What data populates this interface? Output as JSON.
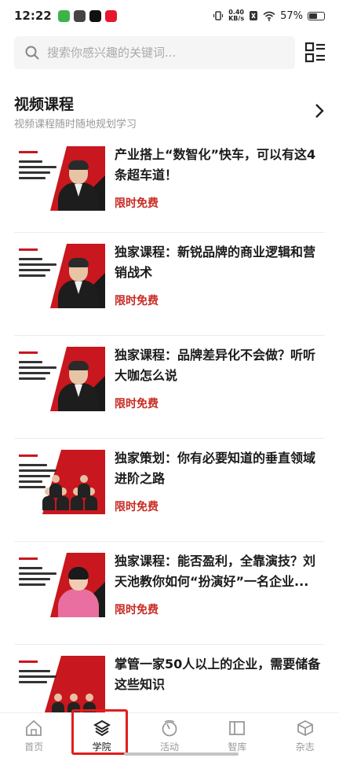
{
  "status_bar": {
    "time": "12:22",
    "net_speed_value": "0.40",
    "net_speed_unit": "KB/s",
    "battery": "57%",
    "battery_level": 0.57
  },
  "search": {
    "placeholder": "搜索你感兴趣的关键词..."
  },
  "section": {
    "title": "视频课程",
    "subtitle": "视频课程随时随地规划学习"
  },
  "courses": [
    {
      "title_line1": "产业搭上“数智化”快车，可以有这4",
      "title_line2": "条超车道！",
      "tag": "限时免费"
    },
    {
      "title_line1": "独家课程：新锐品牌的商业逻辑和营",
      "title_line2": "销战术",
      "tag": "限时免费"
    },
    {
      "title_line1": "独家课程：品牌差异化不会做？听听",
      "title_line2": "大咖怎么说",
      "tag": "限时免费"
    },
    {
      "title_line1": "独家策划：你有必要知道的垂直领域",
      "title_line2": "进阶之路",
      "tag": "限时免费"
    },
    {
      "title_line1": "独家课程：能否盈利，全靠演技？刘",
      "title_line2": "天池教你如何“扮演好”一名企业...",
      "tag": "限时免费"
    },
    {
      "title_line1": "掌管一家50人以上的企业，需要储备",
      "title_line2": "这些知识",
      "tag": ""
    }
  ],
  "nav": [
    {
      "label": "首页",
      "icon": "home-icon"
    },
    {
      "label": "学院",
      "icon": "layers-icon"
    },
    {
      "label": "活动",
      "icon": "activity-icon"
    },
    {
      "label": "智库",
      "icon": "book-icon"
    },
    {
      "label": "杂志",
      "icon": "cube-icon"
    }
  ],
  "colors": {
    "accent_red": "#c82a23",
    "highlight_frame": "#e01e1e"
  }
}
